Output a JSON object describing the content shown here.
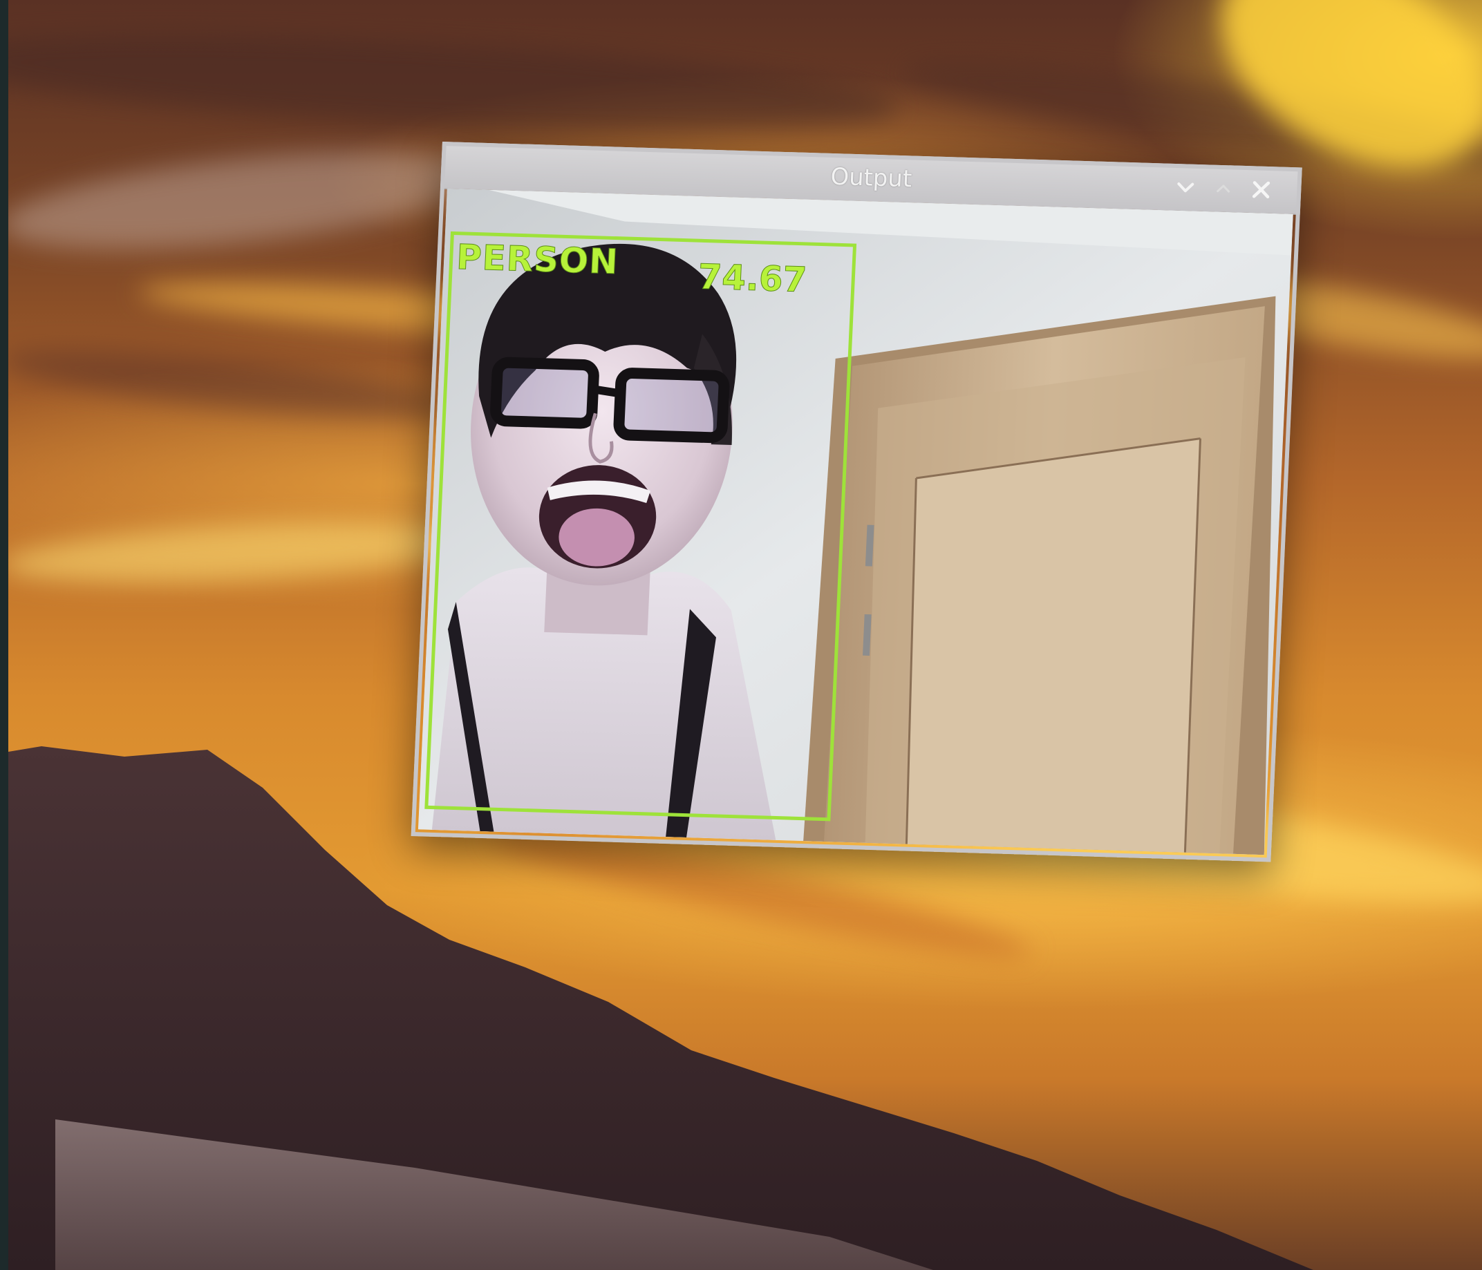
{
  "window": {
    "title": "Output",
    "detection": {
      "label": "PERSON",
      "score": "74.67"
    },
    "controls": {
      "minimize_icon": "chevron-down-icon",
      "maximize_icon": "chevron-up-icon",
      "close_icon": "close-icon"
    }
  },
  "colors": {
    "detection_box": "#9ee23a",
    "titlebar": "#d0cfd2",
    "sky_orange": "#e39a32",
    "mountain": "#3d2a2e"
  }
}
